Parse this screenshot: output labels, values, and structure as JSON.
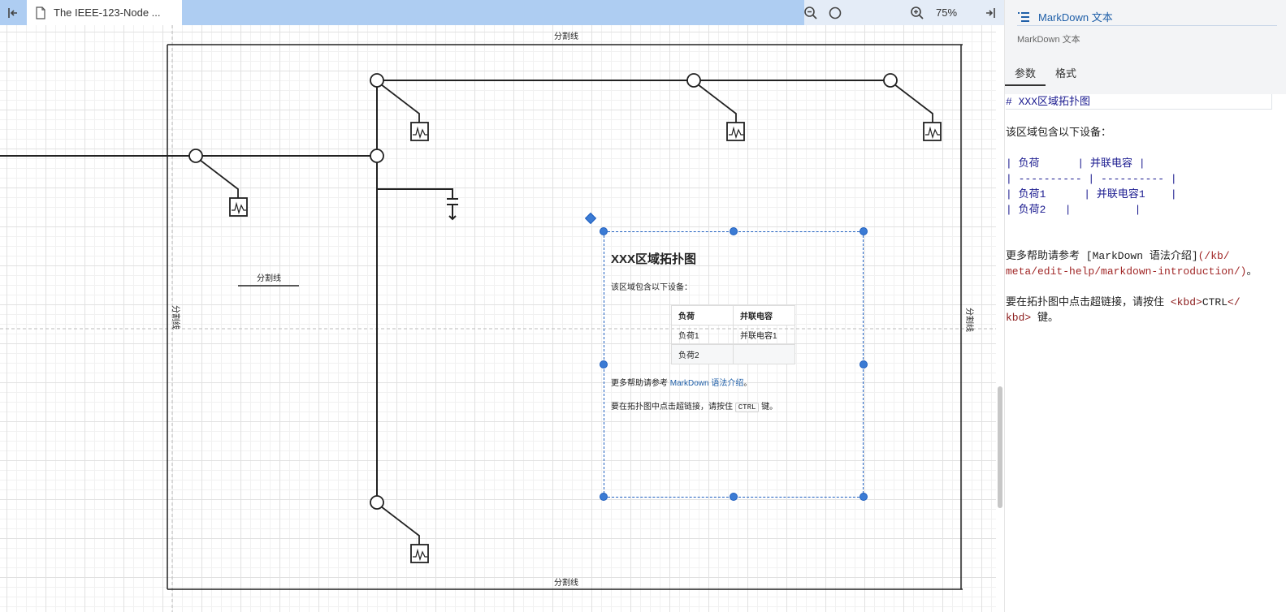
{
  "toolbar": {
    "tab_title": "The IEEE-123-Node ...",
    "zoom_level": "75%"
  },
  "diagram": {
    "labels": {
      "divider_top": "分割线",
      "divider_bottom": "分割线",
      "divider_left": "分割线",
      "divider_right": "分割线",
      "divider_inner": "分割线"
    },
    "markdown_shape": {
      "heading": "XXX区域拓扑图",
      "desc": "该区域包含以下设备：",
      "table_headers": [
        "负荷",
        "并联电容"
      ],
      "table_rows": [
        [
          "负荷1",
          "并联电容1"
        ],
        [
          "负荷2",
          ""
        ]
      ],
      "help_prefix": "更多帮助请参考 ",
      "help_link": "MarkDown 语法介绍",
      "help_suffix": "。",
      "ctrl_prefix": "要在拓扑图中点击超链接，请按住 ",
      "ctrl_key": "CTRL",
      "ctrl_suffix": " 键。"
    }
  },
  "panel": {
    "title": "MarkDown 文本",
    "subtitle": "MarkDown 文本",
    "tabs": [
      "参数",
      "格式"
    ],
    "active_tab": "参数",
    "editor_lines": {
      "l1": "# XXX区域拓扑图",
      "l2": "该区域包含以下设备：",
      "l3": "| 负荷      | 并联电容 |",
      "l4": "| ---------- | ---------- |",
      "l5a": "| 负荷1",
      "l5b": "      | 并联电容1    |",
      "l6a": "| 负荷2",
      "l6b": "   |          |",
      "l7a": "更多帮助请参考 [MarkDown 语法介绍]",
      "l7b": "(/kb/",
      "l8a": "meta/edit-help/markdown-introduction/)",
      "l8b": "。",
      "l9a": "要在拓扑图中点击超链接，请按住 ",
      "l9b": "<kbd>",
      "l9c": "CTRL",
      "l9d": "</",
      "l10a": "kbd>",
      "l10b": " 键。"
    }
  },
  "icons": {
    "collapse": "collapse-left-icon",
    "document": "document-icon",
    "zoom_out": "zoom-out-icon",
    "zoom_fit": "zoom-reset-icon",
    "zoom_in": "zoom-in-icon",
    "expand": "expand-right-icon",
    "panel": "list-icon"
  },
  "colors": {
    "toolbar": "#aecdf2",
    "selection": "#1f5fbf",
    "link": "#1f5fa8"
  }
}
